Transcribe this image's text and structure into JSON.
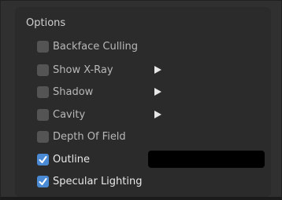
{
  "panel": {
    "header": "Options"
  },
  "options": [
    {
      "label": "Backface Culling",
      "checked": false
    },
    {
      "label": "Show X-Ray",
      "checked": false,
      "submenu": true
    },
    {
      "label": "Shadow",
      "checked": false,
      "submenu": true
    },
    {
      "label": "Cavity",
      "checked": false,
      "submenu": true
    },
    {
      "label": "Depth Of Field",
      "checked": false
    },
    {
      "label": "Outline",
      "checked": true
    },
    {
      "label": "Specular Lighting",
      "checked": true
    }
  ],
  "outline_color": "#000000",
  "colors": {
    "checkbox_on": "#4a89d4",
    "checkbox_off": "#545454",
    "panel_bg": "#2b2b2b"
  }
}
